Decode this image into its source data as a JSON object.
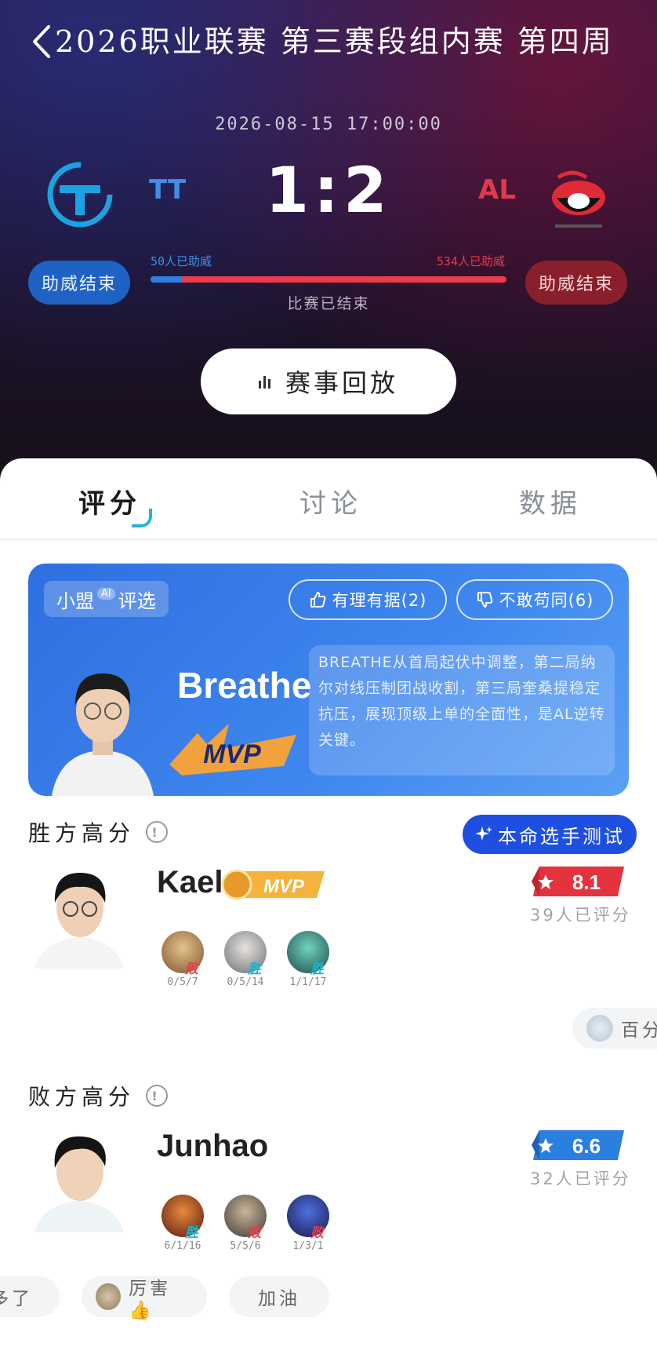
{
  "header": {
    "title": "2026职业联赛 第三赛段组内赛 第四周",
    "datetime": "2026-08-15 17:00:00"
  },
  "match": {
    "team_left": "TT",
    "team_right": "AL",
    "score": "1:2",
    "support_left_label": "助威结束",
    "support_right_label": "助威结束",
    "support_left_count": "50人已助威",
    "support_right_count": "534人已助威",
    "support_left_fraction": 0.086,
    "status": "比赛已结束",
    "replay_label": "赛事回放",
    "colors": {
      "left": "#3f8fe6",
      "right": "#e03b4b"
    }
  },
  "tabs": [
    {
      "label": "评分",
      "active": true
    },
    {
      "label": "讨论",
      "active": false
    },
    {
      "label": "数据",
      "active": false
    }
  ],
  "ai_pick": {
    "tag_prefix": "小盟",
    "tag_sup": "AI",
    "tag_suffix": "评选",
    "agree_label": "有理有据(2)",
    "disagree_label": "不敢苟同(6)",
    "player": "Breathe",
    "badge": "MVP",
    "description": "BREATHE从首局起伏中调整，第二局纳尔对线压制团战收割，第三局奎桑提稳定抗压，展现顶级上单的全面性，是AL逆转关键。"
  },
  "winner_section": {
    "title": "胜方高分",
    "test_button": "本命选手测试",
    "player": "Kael",
    "mvp_badge": "MVP",
    "rating": "8.1",
    "rating_count": "39人已评分",
    "games": [
      {
        "result": "败",
        "kda": "0/5/7"
      },
      {
        "result": "胜",
        "kda": "0/5/14"
      },
      {
        "result": "胜",
        "kda": "1/1/17"
      }
    ]
  },
  "floating_chip": "百分",
  "loser_section": {
    "title": "败方高分",
    "player": "Junhao",
    "rating": "6.6",
    "rating_count": "32人已评分",
    "games": [
      {
        "result": "胜",
        "kda": "6/1/16"
      },
      {
        "result": "败",
        "kda": "5/5/6"
      },
      {
        "result": "败",
        "kda": "1/3/1"
      }
    ]
  },
  "comment_chips": [
    "多了",
    "厉害👍",
    "加油"
  ]
}
